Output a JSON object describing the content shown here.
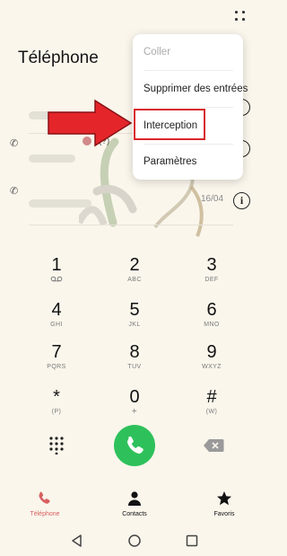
{
  "header": {
    "title": "Téléphone",
    "more_icon": "more-dots-icon"
  },
  "recents": {
    "date": "16/04",
    "partial_text": "(?)"
  },
  "menu": {
    "items": [
      {
        "label": "Coller",
        "disabled": true
      },
      {
        "label": "Supprimer des entrées",
        "disabled": false
      },
      {
        "label": "Interception",
        "disabled": false,
        "highlighted": true
      },
      {
        "label": "Paramètres",
        "disabled": false
      }
    ]
  },
  "keypad": {
    "keys": [
      {
        "digit": "1",
        "letters": "⌨"
      },
      {
        "digit": "2",
        "letters": "ABC"
      },
      {
        "digit": "3",
        "letters": "DEF"
      },
      {
        "digit": "4",
        "letters": "GHI"
      },
      {
        "digit": "5",
        "letters": "JKL"
      },
      {
        "digit": "6",
        "letters": "MNO"
      },
      {
        "digit": "7",
        "letters": "PQRS"
      },
      {
        "digit": "8",
        "letters": "TUV"
      },
      {
        "digit": "9",
        "letters": "WXYZ"
      },
      {
        "digit": "*",
        "letters": "(P)"
      },
      {
        "digit": "0",
        "letters": "+"
      },
      {
        "digit": "#",
        "letters": "(W)"
      }
    ]
  },
  "nav": {
    "items": [
      {
        "label": "Téléphone",
        "active": true,
        "icon": "phone-icon"
      },
      {
        "label": "Contacts",
        "active": false,
        "icon": "contacts-icon"
      },
      {
        "label": "Favoris",
        "active": false,
        "icon": "star-icon"
      }
    ]
  },
  "colors": {
    "background": "#faf6ec",
    "call_button": "#2ec15b",
    "highlight": "#d9262c",
    "active_tab": "#d8605f"
  }
}
